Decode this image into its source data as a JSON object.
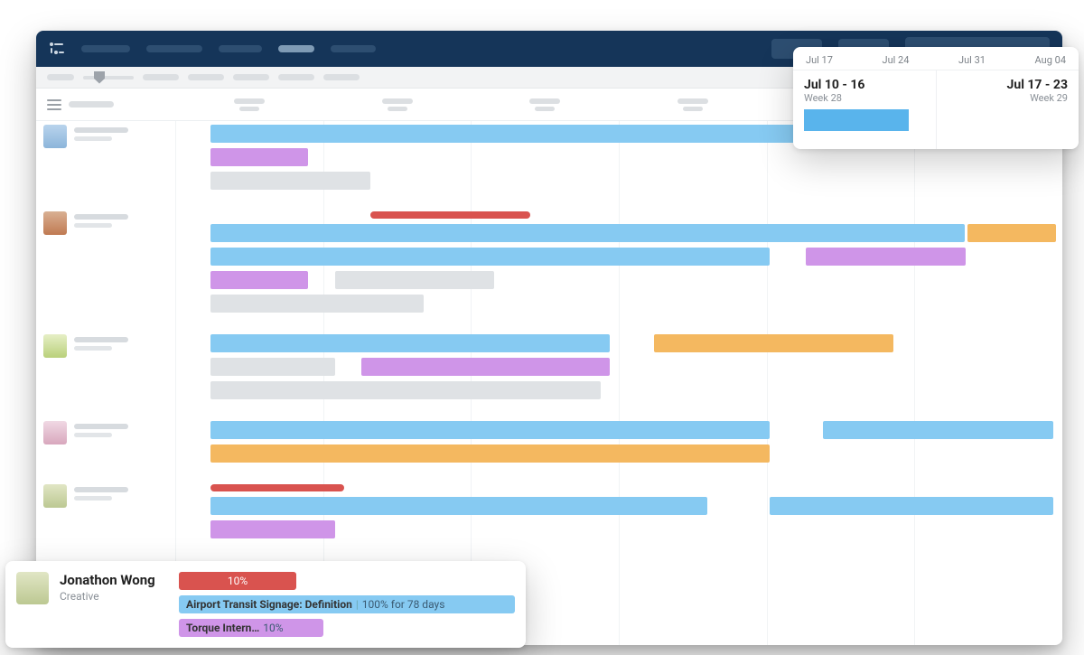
{
  "weekCard": {
    "dates": [
      "Jul 17",
      "Jul 24",
      "Jul 31",
      "Aug 04"
    ],
    "weeks": [
      {
        "range": "Jul 10 - 16",
        "label": "Week 28"
      },
      {
        "range": "Jul 17 - 23",
        "label": "Week 29"
      }
    ]
  },
  "detail": {
    "name": "Jonathon Wong",
    "role": "Creative",
    "utilization": "10%",
    "task1": {
      "title": "Airport Transit Signage: Definition",
      "meta": "100% for 78 days"
    },
    "task2": {
      "title": "Torque Intern…",
      "meta": "10%"
    }
  }
}
